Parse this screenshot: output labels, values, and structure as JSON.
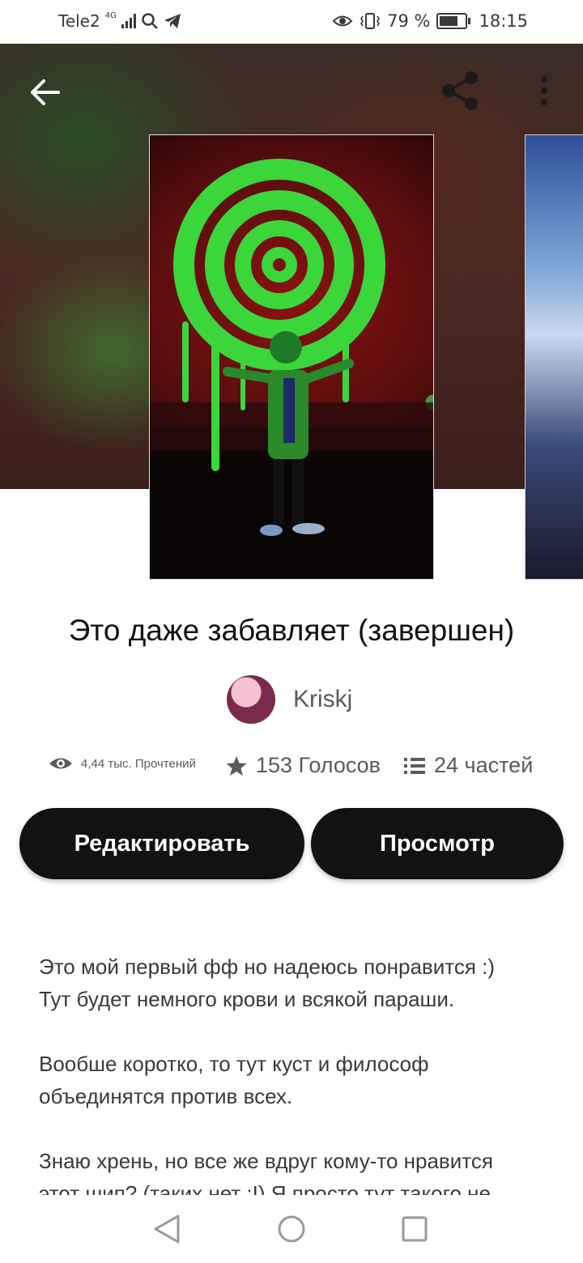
{
  "status_bar": {
    "carrier": "Tele2",
    "network": "4G",
    "battery_percent": "79 %",
    "battery_level": 0.79,
    "time": "18:15",
    "icons": [
      "signal-icon",
      "search-icon",
      "telegram-icon",
      "eye-comfort-icon",
      "vibrate-icon",
      "battery-icon"
    ]
  },
  "story": {
    "title": "Это даже забавляет (завершен)",
    "author": "Kriskj",
    "reads": "4,44 тыс. Прочтений",
    "votes": "153 Голосов",
    "parts": "24 частей"
  },
  "actions": {
    "edit_label": "Редактировать",
    "view_label": "Просмотр"
  },
  "description": {
    "p1_line1": "Это мой первый фф но надеюсь понравится :)",
    "p1_line2": "Тут будет немного крови и всякой параши.",
    "p2_line1": "Вообше коротко, то тут куст и философ",
    "p2_line2": "объединятся против всех.",
    "p3_line1": "Знаю хрень, но все же вдруг кому-то нравится",
    "p3_line2": "этот шип? (таких нет :I) Я просто тут такого не"
  },
  "colors": {
    "button_bg": "#121212",
    "text_primary": "#121212",
    "text_secondary": "#5a5a5a",
    "spiral_green": "#39d833"
  }
}
